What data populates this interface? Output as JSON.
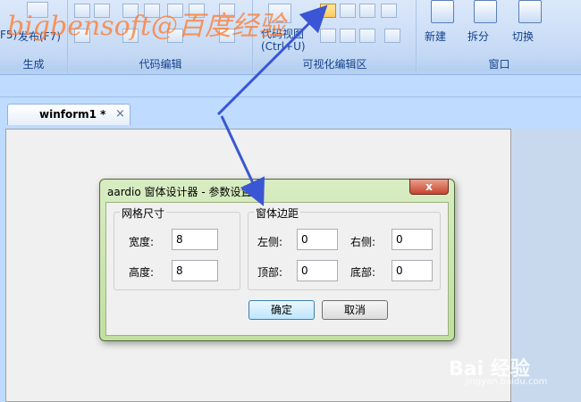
{
  "watermark": "bigbensoft@百度经验",
  "ribbon": {
    "partial_button_f5": "F5)",
    "publish_button": "发布(F7)",
    "group_build": "生成",
    "group_code_edit": "代码编辑",
    "code_view_button": "代码视图",
    "code_view_shortcut": "(Ctrl+U)",
    "group_visual_edit": "可视化编辑区",
    "new_button": "新建",
    "split_button": "拆分",
    "switch_button": "切换",
    "group_window": "窗口"
  },
  "tab": {
    "title": "winform1 *",
    "close": "×"
  },
  "dialog": {
    "title": "aardio 窗体设计器 - 参数设置",
    "close_glyph": "x",
    "grid_group": "网格尺寸",
    "width_label": "宽度:",
    "width_value": "8",
    "height_label": "高度:",
    "height_value": "8",
    "margin_group": "窗体边距",
    "left_label": "左侧:",
    "left_value": "0",
    "right_label": "右侧:",
    "right_value": "0",
    "top_label": "顶部:",
    "top_value": "0",
    "bottom_label": "底部:",
    "bottom_value": "0",
    "ok_button": "确定",
    "cancel_button": "取消"
  },
  "colors": {
    "arrow": "#3a56d4",
    "watermark": "#ff7828",
    "dialog_frame": "#c0dfa0"
  },
  "baidu": {
    "logo": "Bai 经验",
    "url": "jingyan.baidu.com"
  }
}
